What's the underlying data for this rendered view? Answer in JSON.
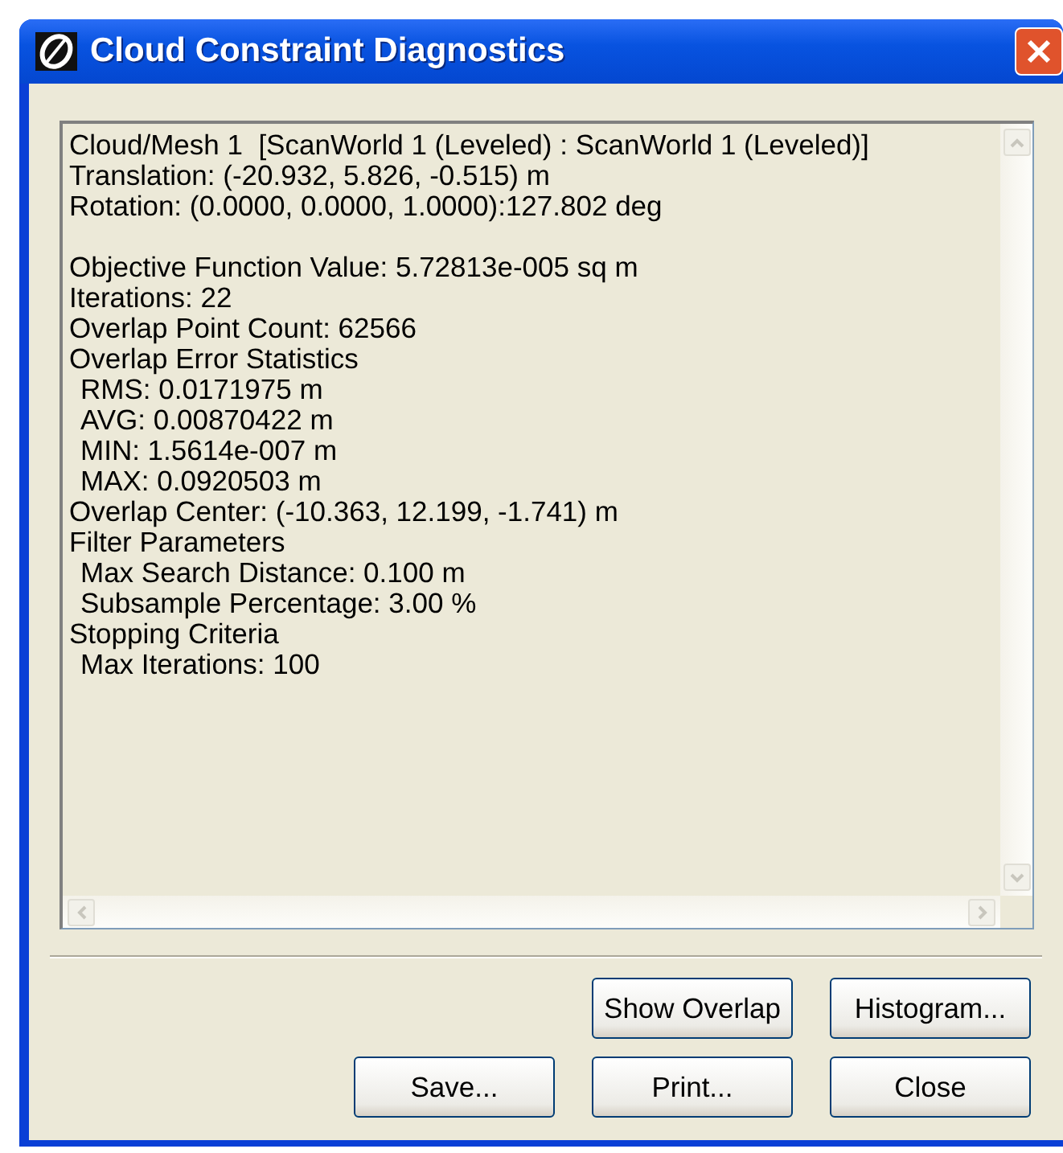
{
  "window": {
    "title": "Cloud Constraint Diagnostics"
  },
  "report": {
    "groups": [
      [
        {
          "text": "Cloud/Mesh 1  [ScanWorld 1 (Leveled) : ScanWorld 1 (Leveled)]"
        },
        {
          "text": "Translation: (-20.932, 5.826, -0.515) m"
        },
        {
          "text": "Rotation: (0.0000, 0.0000, 1.0000):127.802 deg"
        }
      ],
      [
        {
          "text": "Objective Function Value: 5.72813e-005 sq m"
        },
        {
          "text": "Iterations: 22"
        },
        {
          "text": "Overlap Point Count: 62566"
        },
        {
          "text": "Overlap Error Statistics",
          "children": [
            {
              "text": "RMS: 0.0171975 m"
            },
            {
              "text": "AVG: 0.00870422 m"
            },
            {
              "text": "MIN: 1.5614e-007 m"
            },
            {
              "text": "MAX: 0.0920503 m"
            }
          ]
        },
        {
          "text": "Overlap Center: (-10.363, 12.199, -1.741) m"
        },
        {
          "text": "Filter Parameters",
          "children": [
            {
              "text": "Max Search Distance: 0.100 m"
            },
            {
              "text": "Subsample Percentage: 3.00 %"
            }
          ]
        },
        {
          "text": "Stopping Criteria",
          "children": [
            {
              "text": "Max Iterations: 100"
            }
          ]
        }
      ]
    ]
  },
  "button_rows": [
    [
      {
        "label": "Show Overlap"
      },
      {
        "label": "Histogram..."
      }
    ],
    [
      {
        "label": "Save..."
      },
      {
        "label": "Print..."
      },
      {
        "label": "Close"
      }
    ]
  ]
}
